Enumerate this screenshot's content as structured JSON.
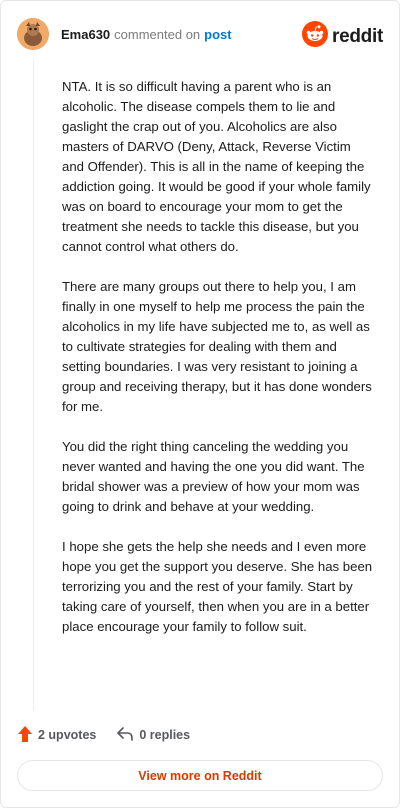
{
  "header": {
    "username": "Ema630",
    "action_text": "commented on",
    "post_link": "post",
    "brand": "reddit"
  },
  "comment": {
    "paragraphs": [
      "NTA. It is so difficult having a parent who is an alcoholic. The disease compels them to lie and gaslight the crap out of you. Alcoholics are also masters of DARVO (Deny, Attack, Reverse Victim and Offender). This is all in the name of keeping the addiction going. It would be good if your whole family was on board to encourage your mom to get the treatment she needs to tackle this disease, but you cannot control what others do.",
      "There are many groups out there to help you, I am finally in one myself to help me process the pain the alcoholics in my life have subjected me to, as well as to cultivate strategies for dealing with them and setting boundaries. I was very resistant to joining a group and receiving therapy, but it has done wonders for me.",
      "You did the right thing canceling the wedding you never wanted and having the one you did want. The bridal shower was a preview of how your mom was going to drink and behave at your wedding.",
      "I hope she gets the help she needs and I even more hope you get the support you deserve. She has been terrorizing you and the rest of your family. Start by taking care of yourself, then when you are in a better place encourage your family to follow suit."
    ]
  },
  "footer": {
    "upvotes": "2 upvotes",
    "replies": "0 replies",
    "view_more": "View more on Reddit"
  },
  "colors": {
    "accent": "#ff4500",
    "link": "#0079d3",
    "view_more_text": "#d93a00"
  },
  "icons": {
    "avatar": "avatar-icon",
    "brand": "reddit-logo-icon",
    "upvote": "upvote-arrow-icon",
    "reply": "reply-arrow-icon"
  }
}
